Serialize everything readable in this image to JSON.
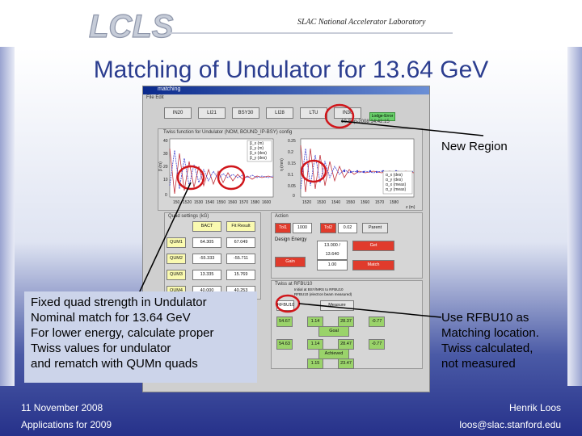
{
  "header": {
    "logo_text": "LCLS",
    "lab": "SLAC National Accelerator Laboratory"
  },
  "title": "Matching of Undulator for 13.64 GeV",
  "gui": {
    "window_title": "matching",
    "menu": "File  Edit",
    "regions": [
      "IN20",
      "LI21",
      "BSY30",
      "LI28",
      "LTU",
      "IN30"
    ],
    "tag": "Lodge-Error",
    "date": "10-Sep-2008 14:42:15",
    "plot_title": "Twiss function for Undulator (NOM, BOUND_IP-BSY) config",
    "plot_left": {
      "ylabel": "β (m)",
      "xticks": [
        "150",
        "1520",
        "1530",
        "1540",
        "1550",
        "1560",
        "1570",
        "1580",
        "1600"
      ],
      "yticks": [
        "40",
        "30",
        "20",
        "10",
        "0"
      ],
      "legend": [
        "β_x (m)",
        "β_y (m)",
        "β_x (des)",
        "β_y (des)"
      ]
    },
    "plot_right": {
      "ylabel": "η (mm)",
      "xlabel": "z (m)",
      "xticks": [
        "1520",
        "1530",
        "1540",
        "1550",
        "1560",
        "1570",
        "1580"
      ],
      "yticks": [
        "0.25",
        "0.2",
        "0.15",
        "0.1",
        "0.05",
        "0"
      ],
      "legend": [
        "α_x (des)",
        "α_y (des)",
        "α_x (meas)",
        "α_y (meas)"
      ]
    },
    "quad_panel": {
      "title": "Quad settings (kG)",
      "headers": [
        "BACT",
        "Fit Result"
      ],
      "rows": [
        {
          "label": "QUM1",
          "bact": "64.305",
          "fit": "67.049"
        },
        {
          "label": "QUM2",
          "bact": "-55.333",
          "fit": "-55.711"
        },
        {
          "label": "QUM3",
          "bact": "13.335",
          "fit": "15.769"
        },
        {
          "label": "QUM4",
          "bact": "40.000",
          "fit": "40.253"
        }
      ]
    },
    "action_panel": {
      "title": "Action",
      "tol1_label": "Tol1",
      "tol1": "1000",
      "tol2_label": "Tol2",
      "tol2": "0.02",
      "parent_label": "Parent",
      "energy_label": "Design Energy",
      "energy": "13.000 / 13.640",
      "energy_btn": "Get",
      "gain_label": "Gain",
      "gain": "1.00",
      "match_btn": "Match"
    },
    "twiss_panel": {
      "title": "Twiss at RFBU10",
      "ref1": "Initial at BSY/MRS to RFBU10",
      "ref2": "RFBU10 (electron beam measured)",
      "location": "RFBU10",
      "measure_btn": "Measure",
      "rows": [
        {
          "label": "Goal",
          "bx": "54.67",
          "ax": "1.14",
          "by": "28.37",
          "ay": "-0.77"
        },
        {
          "label": "Achieved",
          "bx": "54.63",
          "ax": "1.14",
          "by": "28.47",
          "ay": "-0.77"
        }
      ],
      "extra": [
        "23.47",
        "1.15"
      ]
    },
    "chart_data": {
      "type": "line",
      "title": "",
      "xlabel": "",
      "ylabel": "β (m)",
      "ylim": [
        0,
        40
      ]
    }
  },
  "annotations": {
    "new_region": "New Region",
    "left_box": [
      "Fixed quad strength in Undulator",
      "Nominal match for 13.64 GeV",
      "For lower energy, calculate proper",
      "Twiss values for undulator",
      "and rematch with QUMn quads"
    ],
    "right_box": [
      "Use RFBU10 as",
      "Matching location.",
      "Twiss calculated,",
      "not measured"
    ]
  },
  "footer": {
    "date": "11 November 2008",
    "talk": "Applications for 2009",
    "author": "Henrik Loos",
    "email": "loos@slac.stanford.edu"
  },
  "colors": {
    "title": "#2b3d8f",
    "highlight_circle": "#d0161b",
    "green_field": "#9ad36a",
    "red_field": "#e03b2c",
    "yellow_field": "#fafab0"
  }
}
